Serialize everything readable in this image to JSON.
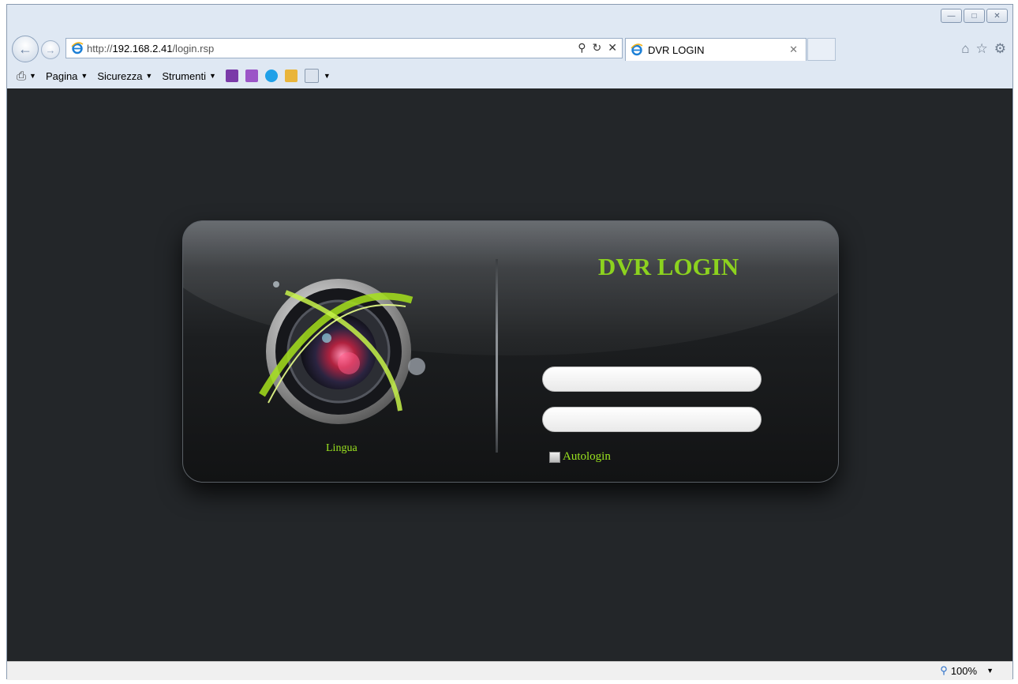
{
  "browser": {
    "address": {
      "protocol": "http://",
      "host": "192.168.2.41",
      "path": "/login.rsp"
    },
    "tab": {
      "title": "DVR LOGIN"
    },
    "command_bar": {
      "items": [
        {
          "label": "Pagina"
        },
        {
          "label": "Sicurezza"
        },
        {
          "label": "Strumenti"
        }
      ]
    },
    "status": {
      "zoom": "100%"
    }
  },
  "login": {
    "title": "DVR LOGIN",
    "language_label": "Lingua",
    "autologin_label": "Autologin",
    "username_value": "",
    "password_value": ""
  },
  "colors": {
    "accent": "#8cd21f",
    "page_bg": "#232629"
  },
  "icons": [
    "back-arrow-icon",
    "forward-arrow-icon",
    "ie-icon",
    "search-icon",
    "refresh-icon",
    "stop-icon",
    "home-icon",
    "favorites-star-icon",
    "settings-gear-icon",
    "print-icon",
    "onenote-icon",
    "skype-icon",
    "zoom-icon",
    "go-arrow-icon",
    "camera-lens-logo"
  ]
}
